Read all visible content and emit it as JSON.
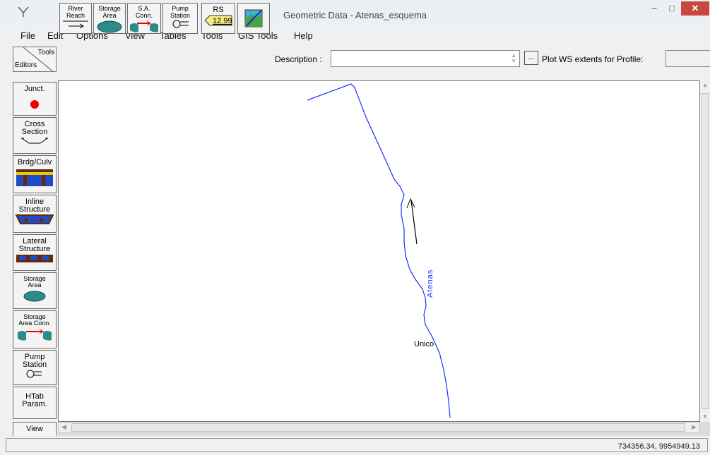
{
  "window": {
    "title": "Geometric Data - Atenas_esquema"
  },
  "menu": [
    "File",
    "Edit",
    "Options",
    "View",
    "Tables",
    "Tools",
    "GIS Tools",
    "Help"
  ],
  "toolbar": {
    "tools_label": "Tools",
    "editors_label": "Editors",
    "river_reach": "River\nReach",
    "storage_area": "Storage\nArea",
    "sa_conn": "S.A.\nConn.",
    "pump_station": "Pump\nStation",
    "rs": "RS",
    "rs_value": "12.99",
    "description_label": "Description :",
    "description_value": "",
    "ellipsis": "...",
    "plot_ws_label": "Plot WS extents for Profile:"
  },
  "sidebar": {
    "junct": "Junct.",
    "cross_section": "Cross\nSection",
    "brdg_culv": "Brdg/Culv",
    "inline_structure": "Inline\nStructure",
    "lateral_structure": "Lateral\nStructure",
    "storage_area": "Storage\nArea",
    "storage_area_conn": "Storage\nArea Conn.",
    "pump_station": "Pump\nStation",
    "htab_param": "HTab\nParam.",
    "view": "View"
  },
  "map": {
    "river_name": "Atenas",
    "reach_name": "Unico"
  },
  "status": {
    "coordinates": "734356.34, 9954949.13"
  },
  "colors": {
    "river": "#1a2dff",
    "close_button": "#c9483d"
  },
  "icons": [
    "hecras-app-icon",
    "minimize-icon",
    "maximize-icon",
    "close-icon",
    "river-reach-icon",
    "storage-area-icon",
    "sa-conn-icon",
    "pump-icon",
    "rs-tag-icon",
    "gis-map-icon",
    "spinner-icon",
    "scroll-arrow-icon"
  ]
}
